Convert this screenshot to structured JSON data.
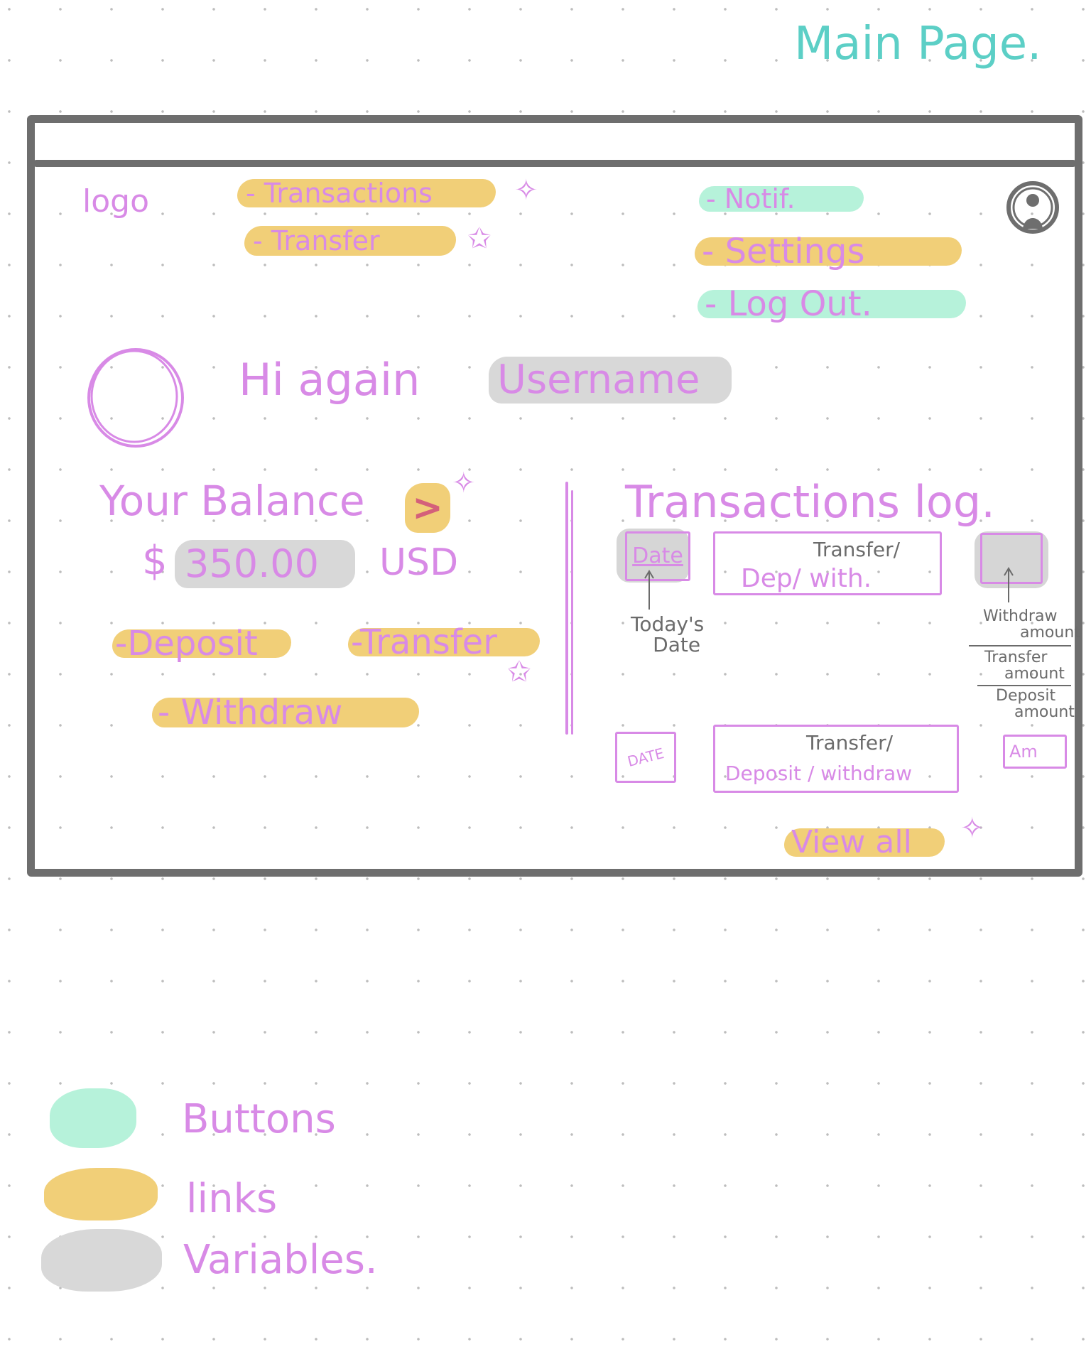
{
  "page_title": "Main Page.",
  "nav": {
    "logo": "logo",
    "links": [
      "- Transactions",
      "- Transfer"
    ],
    "notif": "- Notif.",
    "settings": "- Settings",
    "logout": "- Log Out."
  },
  "greeting": {
    "prefix": "Hi again",
    "username": "Username"
  },
  "balance": {
    "label": "Your Balance",
    "arrow": ">",
    "currency_symbol": "$",
    "amount": "350.00",
    "currency_code": "USD"
  },
  "actions": {
    "deposit": "-Deposit",
    "transfer": "-Transfer",
    "withdraw": "- Withdraw"
  },
  "transactions": {
    "title": "Transactions log.",
    "row1": {
      "date": "Date",
      "type_top": "Transfer/",
      "type_bottom": "Dep/ with."
    },
    "todays_date_note": [
      "Today's",
      "Date"
    ],
    "amount_notes": [
      [
        "Withdraw",
        "amount"
      ],
      [
        "Transfer",
        "amount"
      ],
      [
        "Deposit",
        "amount"
      ]
    ],
    "row2": {
      "date": "DATE",
      "type_top": "Transfer/",
      "type_bottom": "Deposit / withdraw",
      "amount": "Am"
    },
    "view_all": "View all"
  },
  "legend": [
    {
      "label": "Buttons",
      "color": "#b6f2da"
    },
    {
      "label": "links",
      "color": "#f1cf78"
    },
    {
      "label": "Variables.",
      "color": "#d8d8d8"
    }
  ],
  "colors": {
    "title": "#5ccfc6",
    "ink": "#d88ae6",
    "link": "#f1cf78",
    "button": "#b6f2da",
    "variable": "#d8d8d8",
    "frame": "#6e6e6e"
  }
}
